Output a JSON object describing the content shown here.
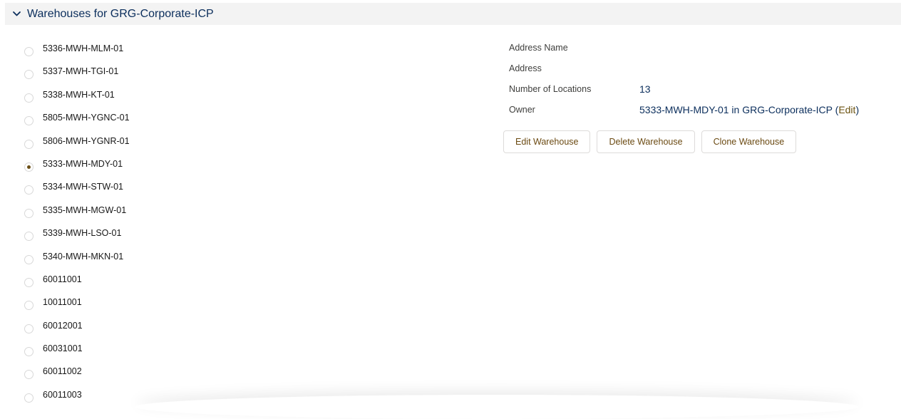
{
  "section": {
    "title": "Warehouses for GRG-Corporate-ICP",
    "icon": "chevron-down-icon"
  },
  "warehouses": [
    {
      "label": "5336-MWH-MLM-01",
      "selected": false
    },
    {
      "label": "5337-MWH-TGI-01",
      "selected": false
    },
    {
      "label": "5338-MWH-KT-01",
      "selected": false
    },
    {
      "label": "5805-MWH-YGNC-01",
      "selected": false
    },
    {
      "label": "5806-MWH-YGNR-01",
      "selected": false
    },
    {
      "label": "5333-MWH-MDY-01",
      "selected": true
    },
    {
      "label": "5334-MWH-STW-01",
      "selected": false
    },
    {
      "label": "5335-MWH-MGW-01",
      "selected": false
    },
    {
      "label": "5339-MWH-LSO-01",
      "selected": false
    },
    {
      "label": "5340-MWH-MKN-01",
      "selected": false
    },
    {
      "label": "60011001",
      "selected": false
    },
    {
      "label": "10011001",
      "selected": false
    },
    {
      "label": "60012001",
      "selected": false
    },
    {
      "label": "60031001",
      "selected": false
    },
    {
      "label": "60011002",
      "selected": false
    },
    {
      "label": "60011003",
      "selected": false
    }
  ],
  "details": {
    "address_name_label": "Address Name",
    "address_name_value": "",
    "address_label": "Address",
    "address_value": "",
    "locations_label": "Number of Locations",
    "locations_value": "13",
    "owner_label": "Owner",
    "owner_value": "5333-MWH-MDY-01 in GRG-Corporate-ICP",
    "owner_edit_open": " (",
    "owner_edit_label": "Edit",
    "owner_edit_close": ")"
  },
  "buttons": {
    "edit": "Edit Warehouse",
    "delete": "Delete Warehouse",
    "clone": "Clone Warehouse"
  },
  "colors": {
    "header_bg": "#f3f3f3",
    "title": "#0b2e5c",
    "button_text": "#6b4a12",
    "radio_checked": "#6b4f16"
  }
}
